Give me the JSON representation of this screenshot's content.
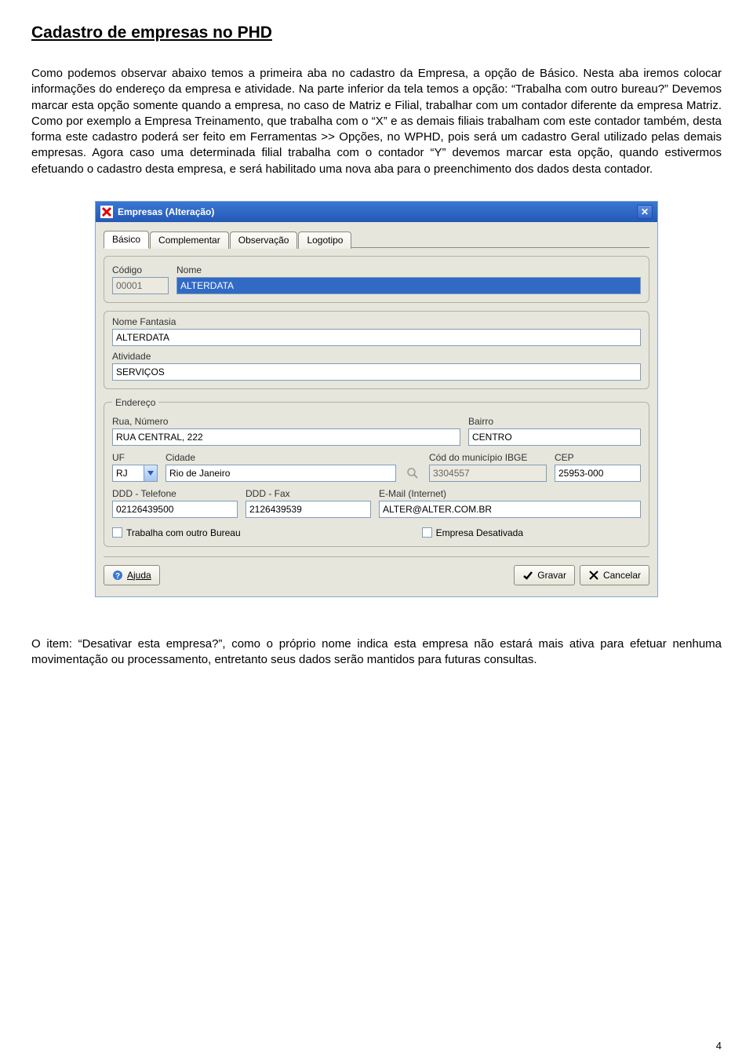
{
  "doc": {
    "heading": "Cadastro de empresas no PHD",
    "paragraph": "Como podemos observar abaixo temos a primeira aba no cadastro da Empresa, a opção de Básico. Nesta aba iremos colocar informações do endereço da empresa e atividade. Na parte inferior da tela temos a opção: “Trabalha com outro bureau?” Devemos marcar esta opção somente quando a empresa, no caso de Matriz e Filial, trabalhar com um contador diferente da empresa Matriz. Como por exemplo a Empresa Treinamento, que trabalha com o “X” e as demais filiais trabalham com este contador também, desta forma este cadastro poderá ser feito em Ferramentas >> Opções, no WPHD, pois será um cadastro Geral utilizado pelas demais empresas. Agora caso uma determinada filial trabalha com o contador “Y” devemos marcar esta opção, quando estivermos efetuando o cadastro desta empresa, e será habilitado uma nova aba para o preenchimento dos dados desta contador.",
    "outro": "O item: “Desativar esta empresa?”, como o próprio nome indica esta empresa não estará mais ativa para efetuar nenhuma movimentação ou processamento, entretanto seus dados serão mantidos para futuras consultas.",
    "page_number": "4"
  },
  "window": {
    "title": "Empresas (Alteração)",
    "tabs": [
      "Básico",
      "Complementar",
      "Observação",
      "Logotipo"
    ],
    "labels": {
      "codigo": "Código",
      "nome": "Nome",
      "nome_fantasia": "Nome Fantasia",
      "atividade": "Atividade",
      "endereco_legend": "Endereço",
      "rua_numero": "Rua, Número",
      "bairro": "Bairro",
      "uf": "UF",
      "cidade": "Cidade",
      "cod_ibge": "Cód do município IBGE",
      "cep": "CEP",
      "ddd_tel": "DDD - Telefone",
      "ddd_fax": "DDD - Fax",
      "email": "E-Mail (Internet)",
      "cb_bureau": "Trabalha com outro Bureau",
      "cb_desativada": "Empresa Desativada"
    },
    "values": {
      "codigo": "00001",
      "nome": "ALTERDATA",
      "nome_fantasia": "ALTERDATA",
      "atividade": "SERVIÇOS",
      "rua_numero": "RUA CENTRAL, 222",
      "bairro": "CENTRO",
      "uf": "RJ",
      "cidade": "Rio de Janeiro",
      "cod_ibge": "3304557",
      "cep": "25953-000",
      "ddd_tel": "02126439500",
      "ddd_fax": "2126439539",
      "email": "ALTER@ALTER.COM.BR"
    },
    "buttons": {
      "ajuda": "Ajuda",
      "gravar": "Gravar",
      "cancelar": "Cancelar"
    }
  }
}
